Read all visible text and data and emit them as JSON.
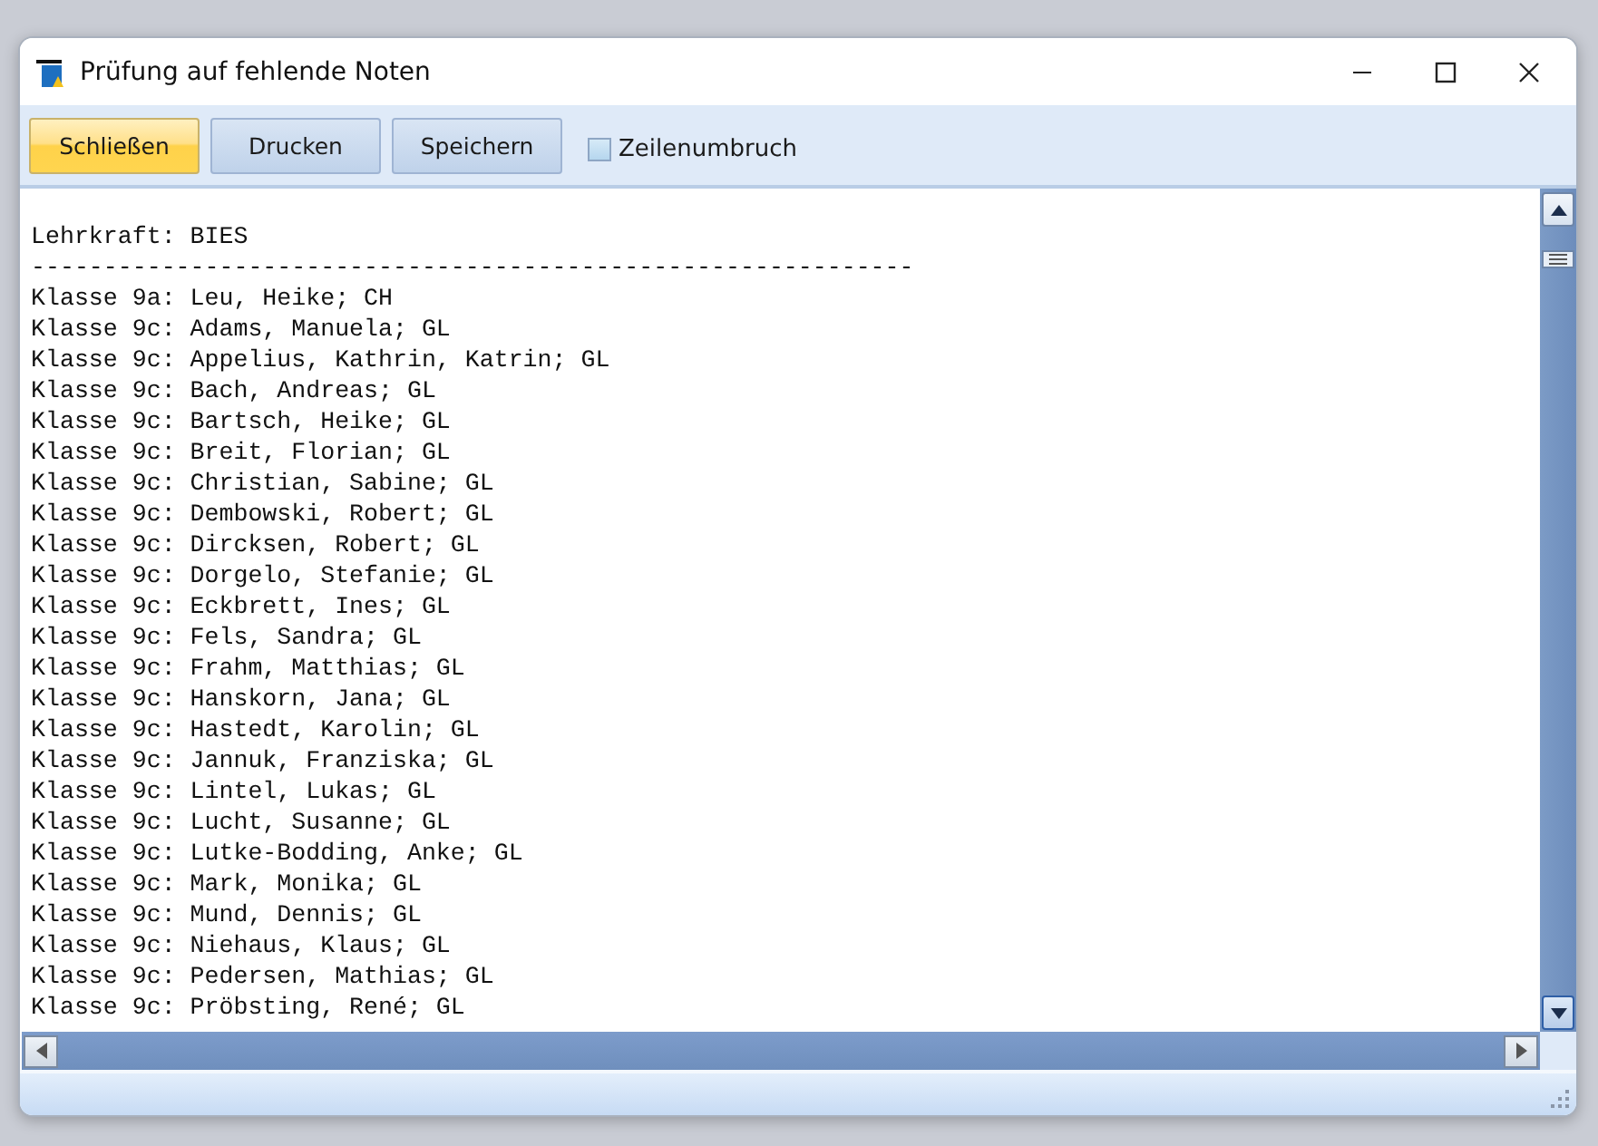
{
  "window": {
    "title": "Prüfung auf fehlende Noten"
  },
  "toolbar": {
    "buttons": [
      {
        "label": "Schließen",
        "selected": true
      },
      {
        "label": "Drucken",
        "selected": false
      },
      {
        "label": "Speichern",
        "selected": false
      }
    ],
    "wrap_checkbox": {
      "label": "Zeilenumbruch",
      "checked": false
    }
  },
  "report": {
    "lines": [
      "Lehrkraft: BIES",
      "-------------------------------------------------------------",
      "Klasse 9a: Leu, Heike; CH",
      "Klasse 9c: Adams, Manuela; GL",
      "Klasse 9c: Appelius, Kathrin, Katrin; GL",
      "Klasse 9c: Bach, Andreas; GL",
      "Klasse 9c: Bartsch, Heike; GL",
      "Klasse 9c: Breit, Florian; GL",
      "Klasse 9c: Christian, Sabine; GL",
      "Klasse 9c: Dembowski, Robert; GL",
      "Klasse 9c: Dircksen, Robert; GL",
      "Klasse 9c: Dorgelo, Stefanie; GL",
      "Klasse 9c: Eckbrett, Ines; GL",
      "Klasse 9c: Fels, Sandra; GL",
      "Klasse 9c: Frahm, Matthias; GL",
      "Klasse 9c: Hanskorn, Jana; GL",
      "Klasse 9c: Hastedt, Karolin; GL",
      "Klasse 9c: Jannuk, Franziska; GL",
      "Klasse 9c: Lintel, Lukas; GL",
      "Klasse 9c: Lucht, Susanne; GL",
      "Klasse 9c: Lutke-Bodding, Anke; GL",
      "Klasse 9c: Mark, Monika; GL",
      "Klasse 9c: Mund, Dennis; GL",
      "Klasse 9c: Niehaus, Klaus; GL",
      "Klasse 9c: Pedersen, Mathias; GL",
      "Klasse 9c: Pröbsting, René; GL"
    ]
  }
}
